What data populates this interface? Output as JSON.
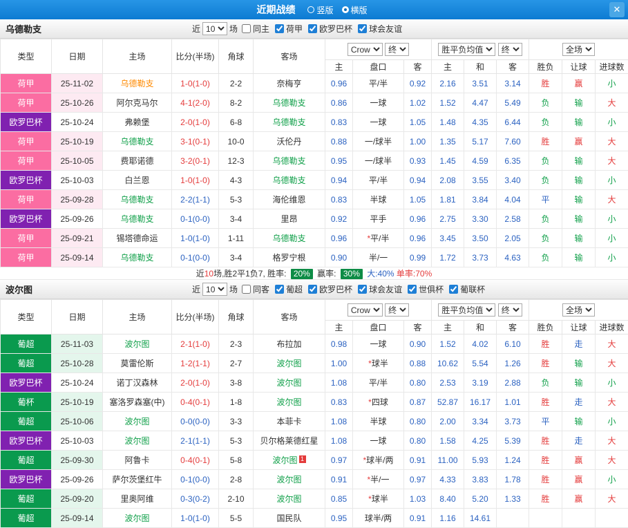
{
  "topbar": {
    "title": "近期战绩",
    "radios": [
      {
        "label": "竖版",
        "selected": false
      },
      {
        "label": "横版",
        "selected": true
      }
    ],
    "close_icon": "✕"
  },
  "table_header": {
    "type": "类型",
    "date": "日期",
    "home": "主场",
    "score": "比分(半场)",
    "corner": "角球",
    "away": "客场",
    "odds_source": "Crow",
    "odds_time": "终",
    "odds_home": "主",
    "odds_handicap": "盘口",
    "odds_away": "客",
    "avg_source": "胜平负均值",
    "avg_time": "终",
    "avg_home": "主",
    "avg_draw": "和",
    "avg_away": "客",
    "full_scope": "全场",
    "col_result": "胜负",
    "col_let": "让球",
    "col_goals": "进球数"
  },
  "sections": [
    {
      "team": "乌德勒支",
      "near_label": "近",
      "near_count": "10",
      "games_label": "场",
      "checkboxes": [
        {
          "label": "同主",
          "checked": false
        },
        {
          "label": "荷甲",
          "checked": true
        },
        {
          "label": "欧罗巴杯",
          "checked": true
        },
        {
          "label": "球会友谊",
          "checked": true
        }
      ],
      "rows": [
        {
          "league": "荷甲",
          "style": "pink",
          "date": "25-11-02",
          "home": "乌德勒支",
          "home_color": "orange",
          "score": "1-0(1-0)",
          "score_color": "red",
          "corner": "2-2",
          "away": "奈梅亨",
          "away_color": "black",
          "odds_home": "0.96",
          "handicap": "平/半",
          "star": false,
          "odds_away": "0.92",
          "avg_home": "2.16",
          "avg_draw": "3.51",
          "avg_away": "3.14",
          "result": "胜",
          "result_color": "red",
          "let_result": "赢",
          "let_color": "red",
          "goals": "小",
          "goals_color": "green"
        },
        {
          "league": "荷甲",
          "style": "pink",
          "date": "25-10-26",
          "home": "阿尔克马尔",
          "home_color": "black",
          "score": "4-1(2-0)",
          "score_color": "red",
          "corner": "8-2",
          "away": "乌德勒支",
          "away_color": "green",
          "odds_home": "0.86",
          "handicap": "一球",
          "star": false,
          "odds_away": "1.02",
          "avg_home": "1.52",
          "avg_draw": "4.47",
          "avg_away": "5.49",
          "result": "负",
          "result_color": "green",
          "let_result": "输",
          "let_color": "green",
          "goals": "大",
          "goals_color": "red"
        },
        {
          "league": "欧罗巴杯",
          "style": "purple",
          "date": "25-10-24",
          "home": "弗赖堡",
          "home_color": "black",
          "score": "2-0(1-0)",
          "score_color": "red",
          "corner": "6-8",
          "away": "乌德勒支",
          "away_color": "green",
          "odds_home": "0.83",
          "handicap": "一球",
          "star": false,
          "odds_away": "1.05",
          "avg_home": "1.48",
          "avg_draw": "4.35",
          "avg_away": "6.44",
          "result": "负",
          "result_color": "green",
          "let_result": "输",
          "let_color": "green",
          "goals": "小",
          "goals_color": "green"
        },
        {
          "league": "荷甲",
          "style": "pink",
          "date": "25-10-19",
          "home": "乌德勒支",
          "home_color": "green",
          "score": "3-1(0-1)",
          "score_color": "red",
          "corner": "10-0",
          "away": "沃伦丹",
          "away_color": "black",
          "odds_home": "0.88",
          "handicap": "一/球半",
          "star": false,
          "odds_away": "1.00",
          "avg_home": "1.35",
          "avg_draw": "5.17",
          "avg_away": "7.60",
          "result": "胜",
          "result_color": "red",
          "let_result": "赢",
          "let_color": "red",
          "goals": "大",
          "goals_color": "red"
        },
        {
          "league": "荷甲",
          "style": "pink",
          "date": "25-10-05",
          "home": "费耶诺德",
          "home_color": "black",
          "score": "3-2(0-1)",
          "score_color": "red",
          "corner": "12-3",
          "away": "乌德勒支",
          "away_color": "green",
          "odds_home": "0.95",
          "handicap": "一/球半",
          "star": false,
          "odds_away": "0.93",
          "avg_home": "1.45",
          "avg_draw": "4.59",
          "avg_away": "6.35",
          "result": "负",
          "result_color": "green",
          "let_result": "输",
          "let_color": "green",
          "goals": "大",
          "goals_color": "red"
        },
        {
          "league": "欧罗巴杯",
          "style": "purple",
          "date": "25-10-03",
          "home": "白兰恩",
          "home_color": "black",
          "score": "1-0(1-0)",
          "score_color": "red",
          "corner": "4-3",
          "away": "乌德勒支",
          "away_color": "green",
          "odds_home": "0.94",
          "handicap": "平/半",
          "star": false,
          "odds_away": "0.94",
          "avg_home": "2.08",
          "avg_draw": "3.55",
          "avg_away": "3.40",
          "result": "负",
          "result_color": "green",
          "let_result": "输",
          "let_color": "green",
          "goals": "小",
          "goals_color": "green"
        },
        {
          "league": "荷甲",
          "style": "pink",
          "date": "25-09-28",
          "home": "乌德勒支",
          "home_color": "green",
          "score": "2-2(1-1)",
          "score_color": "blue",
          "corner": "5-3",
          "away": "海伦维恩",
          "away_color": "black",
          "odds_home": "0.83",
          "handicap": "半球",
          "star": false,
          "odds_away": "1.05",
          "avg_home": "1.81",
          "avg_draw": "3.84",
          "avg_away": "4.04",
          "result": "平",
          "result_color": "blue",
          "let_result": "输",
          "let_color": "green",
          "goals": "大",
          "goals_color": "red"
        },
        {
          "league": "欧罗巴杯",
          "style": "purple",
          "date": "25-09-26",
          "home": "乌德勒支",
          "home_color": "green",
          "score": "0-1(0-0)",
          "score_color": "blue",
          "corner": "3-4",
          "away": "里昂",
          "away_color": "black",
          "odds_home": "0.92",
          "handicap": "平手",
          "star": false,
          "odds_away": "0.96",
          "avg_home": "2.75",
          "avg_draw": "3.30",
          "avg_away": "2.58",
          "result": "负",
          "result_color": "green",
          "let_result": "输",
          "let_color": "green",
          "goals": "小",
          "goals_color": "green"
        },
        {
          "league": "荷甲",
          "style": "pink",
          "date": "25-09-21",
          "home": "锡塔德命运",
          "home_color": "black",
          "score": "1-0(1-0)",
          "score_color": "blue",
          "corner": "1-11",
          "away": "乌德勒支",
          "away_color": "green",
          "odds_home": "0.96",
          "handicap": "平/半",
          "star": true,
          "odds_away": "0.96",
          "avg_home": "3.45",
          "avg_draw": "3.50",
          "avg_away": "2.05",
          "result": "负",
          "result_color": "green",
          "let_result": "输",
          "let_color": "green",
          "goals": "小",
          "goals_color": "green"
        },
        {
          "league": "荷甲",
          "style": "pink",
          "date": "25-09-14",
          "home": "乌德勒支",
          "home_color": "green",
          "score": "0-1(0-0)",
          "score_color": "blue",
          "corner": "3-4",
          "away": "格罗宁根",
          "away_color": "black",
          "odds_home": "0.90",
          "handicap": "半/一",
          "star": false,
          "odds_away": "0.99",
          "avg_home": "1.72",
          "avg_draw": "3.73",
          "avg_away": "4.63",
          "result": "负",
          "result_color": "green",
          "let_result": "输",
          "let_color": "green",
          "goals": "小",
          "goals_color": "green"
        }
      ],
      "summary": [
        {
          "text": "近",
          "style": "plain"
        },
        {
          "text": "10",
          "style": "red"
        },
        {
          "text": "场,胜2平1负7, 胜率: ",
          "style": "plain"
        },
        {
          "text": "20%",
          "style": "badge"
        },
        {
          "text": " 赢率: ",
          "style": "plain"
        },
        {
          "text": "30%",
          "style": "badge"
        },
        {
          "text": " 大:40%",
          "style": "blue"
        },
        {
          "text": " 单率:70%",
          "style": "red"
        }
      ]
    },
    {
      "team": "波尔图",
      "near_label": "近",
      "near_count": "10",
      "games_label": "场",
      "checkboxes": [
        {
          "label": "同客",
          "checked": false
        },
        {
          "label": "葡超",
          "checked": true
        },
        {
          "label": "欧罗巴杯",
          "checked": true
        },
        {
          "label": "球会友谊",
          "checked": true
        },
        {
          "label": "世俱杯",
          "checked": true
        },
        {
          "label": "葡联杯",
          "checked": true
        }
      ],
      "rows": [
        {
          "league": "葡超",
          "style": "green",
          "date": "25-11-03",
          "home": "波尔图",
          "home_color": "green",
          "score": "2-1(1-0)",
          "score_color": "red",
          "corner": "2-3",
          "away": "布拉加",
          "away_color": "black",
          "odds_home": "0.98",
          "handicap": "一球",
          "star": false,
          "odds_away": "0.90",
          "avg_home": "1.52",
          "avg_draw": "4.02",
          "avg_away": "6.10",
          "result": "胜",
          "result_color": "red",
          "let_result": "走",
          "let_color": "blue",
          "goals": "大",
          "goals_color": "red"
        },
        {
          "league": "葡超",
          "style": "green",
          "date": "25-10-28",
          "home": "莫雷伦斯",
          "home_color": "black",
          "score": "1-2(1-1)",
          "score_color": "red",
          "corner": "2-7",
          "away": "波尔图",
          "away_color": "green",
          "odds_home": "1.00",
          "handicap": "球半",
          "star": true,
          "odds_away": "0.88",
          "avg_home": "10.62",
          "avg_draw": "5.54",
          "avg_away": "1.26",
          "result": "胜",
          "result_color": "red",
          "let_result": "输",
          "let_color": "green",
          "goals": "大",
          "goals_color": "red"
        },
        {
          "league": "欧罗巴杯",
          "style": "purple",
          "date": "25-10-24",
          "home": "诺丁汉森林",
          "home_color": "black",
          "score": "2-0(1-0)",
          "score_color": "red",
          "corner": "3-8",
          "away": "波尔图",
          "away_color": "green",
          "odds_home": "1.08",
          "handicap": "平/半",
          "star": false,
          "odds_away": "0.80",
          "avg_home": "2.53",
          "avg_draw": "3.19",
          "avg_away": "2.88",
          "result": "负",
          "result_color": "green",
          "let_result": "输",
          "let_color": "green",
          "goals": "小",
          "goals_color": "green"
        },
        {
          "league": "葡杯",
          "style": "green",
          "date": "25-10-19",
          "home": "塞洛罗森塞(中)",
          "home_color": "black",
          "score": "0-4(0-1)",
          "score_color": "red",
          "corner": "1-8",
          "away": "波尔图",
          "away_color": "green",
          "odds_home": "0.83",
          "handicap": "四球",
          "star": true,
          "odds_away": "0.87",
          "avg_home": "52.87",
          "avg_draw": "16.17",
          "avg_away": "1.01",
          "result": "胜",
          "result_color": "red",
          "let_result": "走",
          "let_color": "blue",
          "goals": "大",
          "goals_color": "red"
        },
        {
          "league": "葡超",
          "style": "green",
          "date": "25-10-06",
          "home": "波尔图",
          "home_color": "green",
          "score": "0-0(0-0)",
          "score_color": "blue",
          "corner": "3-3",
          "away": "本菲卡",
          "away_color": "black",
          "odds_home": "1.08",
          "handicap": "半球",
          "star": false,
          "odds_away": "0.80",
          "avg_home": "2.00",
          "avg_draw": "3.34",
          "avg_away": "3.73",
          "result": "平",
          "result_color": "blue",
          "let_result": "输",
          "let_color": "green",
          "goals": "小",
          "goals_color": "green"
        },
        {
          "league": "欧罗巴杯",
          "style": "purple",
          "date": "25-10-03",
          "home": "波尔图",
          "home_color": "green",
          "score": "2-1(1-1)",
          "score_color": "blue",
          "corner": "5-3",
          "away": "贝尔格莱德红星",
          "away_color": "black",
          "odds_home": "1.08",
          "handicap": "一球",
          "star": false,
          "odds_away": "0.80",
          "avg_home": "1.58",
          "avg_draw": "4.25",
          "avg_away": "5.39",
          "result": "胜",
          "result_color": "red",
          "let_result": "走",
          "let_color": "blue",
          "goals": "大",
          "goals_color": "red"
        },
        {
          "league": "葡超",
          "style": "green",
          "date": "25-09-30",
          "home": "阿鲁卡",
          "home_color": "black",
          "score": "0-4(0-1)",
          "score_color": "red",
          "corner": "5-8",
          "away": "波尔图",
          "away_color": "green",
          "away_badge": "1",
          "odds_home": "0.97",
          "handicap": "球半/两",
          "star": true,
          "odds_away": "0.91",
          "avg_home": "11.00",
          "avg_draw": "5.93",
          "avg_away": "1.24",
          "result": "胜",
          "result_color": "red",
          "let_result": "赢",
          "let_color": "red",
          "goals": "大",
          "goals_color": "red"
        },
        {
          "league": "欧罗巴杯",
          "style": "purple",
          "date": "25-09-26",
          "home": "萨尔茨堡红牛",
          "home_color": "black",
          "score": "0-1(0-0)",
          "score_color": "blue",
          "corner": "2-8",
          "away": "波尔图",
          "away_color": "green",
          "odds_home": "0.91",
          "handicap": "半/一",
          "star": true,
          "odds_away": "0.97",
          "avg_home": "4.33",
          "avg_draw": "3.83",
          "avg_away": "1.78",
          "result": "胜",
          "result_color": "red",
          "let_result": "赢",
          "let_color": "red",
          "goals": "小",
          "goals_color": "green"
        },
        {
          "league": "葡超",
          "style": "green",
          "date": "25-09-20",
          "home": "里奥阿维",
          "home_color": "black",
          "score": "0-3(0-2)",
          "score_color": "blue",
          "corner": "2-10",
          "away": "波尔图",
          "away_color": "green",
          "odds_home": "0.85",
          "handicap": "球半",
          "star": true,
          "odds_away": "1.03",
          "avg_home": "8.40",
          "avg_draw": "5.20",
          "avg_away": "1.33",
          "result": "胜",
          "result_color": "red",
          "let_result": "赢",
          "let_color": "red",
          "goals": "大",
          "goals_color": "red"
        },
        {
          "league": "葡超",
          "style": "green",
          "date": "25-09-14",
          "home": "波尔图",
          "home_color": "green",
          "score": "1-0(1-0)",
          "score_color": "blue",
          "corner": "5-5",
          "away": "国民队",
          "away_color": "black",
          "odds_home": "0.95",
          "handicap": "球半/两",
          "star": false,
          "odds_away": "0.91",
          "avg_home": "1.16",
          "avg_draw": "14.61",
          "avg_away": "",
          "result": "",
          "result_color": "",
          "let_result": "",
          "let_color": "",
          "goals": "",
          "goals_color": ""
        }
      ],
      "summary": []
    }
  ]
}
